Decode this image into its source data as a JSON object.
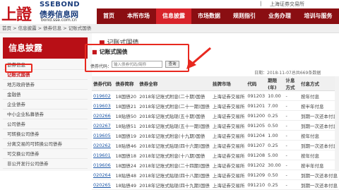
{
  "logo": {
    "cn": "上證",
    "en": "SSEBOND",
    "sub": "债券信息网",
    "url": "bond.sse.com.cn"
  },
  "topbar": {
    "sep": "|",
    "link": "上海证券交易所"
  },
  "nav": [
    {
      "label": "首页"
    },
    {
      "label": "本所市场"
    },
    {
      "label": "信息披露"
    },
    {
      "label": "市场数据"
    },
    {
      "label": "规则指引"
    },
    {
      "label": "业务办理"
    },
    {
      "label": "培训与服务"
    }
  ],
  "breadcrumb": "首页 > 信息披露 > 债券信息 > 记账式国债",
  "sidebar": {
    "title": "信息披露",
    "items": [
      {
        "label": "债券信息"
      },
      {
        "label": "记账式国债"
      },
      {
        "label": "地方政府债券"
      },
      {
        "label": "金融债"
      },
      {
        "label": "企业债券"
      },
      {
        "label": "中小企业私募债券"
      },
      {
        "label": "公司债券"
      },
      {
        "label": "可转换公司债券"
      },
      {
        "label": "分离交易的可转换公司债券"
      },
      {
        "label": "可交换公司债券"
      },
      {
        "label": "非公开发行公司债券"
      }
    ]
  },
  "content": {
    "title": "记账式国债",
    "search": {
      "title": "记账式国债",
      "label": "债券代码：",
      "placeholder": "输入债券代码/简称",
      "button": "查询"
    },
    "dateline": "日期：2018-11-07总共669条数据"
  },
  "table": {
    "headers": [
      "债券代码",
      "债券简称",
      "债券全称",
      "挂牌市场",
      "代码",
      "期限(年)",
      "计息方式",
      "付息方式"
    ],
    "rows": [
      [
        "019602",
        "18国债20",
        "2018年记账式附息(二十期)国债",
        "上海证券交易所",
        "091203",
        "10.00",
        "-",
        "按年付息"
      ],
      [
        "019603",
        "18国债21",
        "2018年记账式附息(二十一期)国债",
        "上海证券交易所",
        "091201",
        "7.00",
        "-",
        "按半年付息"
      ],
      [
        "020266",
        "18贴债50",
        "2018年记账式贴现(五十期)国债",
        "上海证券交易所",
        "091200",
        "0.25",
        "-",
        "到期一次还本付息"
      ],
      [
        "020267",
        "18贴债51",
        "2018年记账式贴现(五十一期)国债",
        "上海证券交易所",
        "091205",
        "0.50",
        "-",
        "到期一次还本付息"
      ],
      [
        "019605",
        "18国债19",
        "2018年记账式附息(十九期)国债",
        "上海证券交易所",
        "091204",
        "1.00",
        "-",
        "按年付息"
      ],
      [
        "020262",
        "18贴债46",
        "2018年记账式贴现(四十六期)国债",
        "上海证券交易所",
        "091207",
        "0.25",
        "-",
        "到期一次还本付息"
      ],
      [
        "019601",
        "18国债18",
        "2018年记账式附息(十八期)国债",
        "上海证券交易所",
        "091208",
        "5.00",
        "-",
        "按年付息"
      ],
      [
        "019606",
        "18国债24",
        "2018年记账式附息(二十四期)国债",
        "上海证券交易所",
        "091202",
        "30.00",
        "-",
        "按半年付息"
      ],
      [
        "020264",
        "18贴债48",
        "2018年记账式贴现(四十八期)国债",
        "上海证券交易所",
        "091209",
        "0.50",
        "-",
        "到期一次还本付息"
      ],
      [
        "020265",
        "18贴债49",
        "2018年记账式贴现(四十九期)国债",
        "上海证券交易所",
        "091210",
        "0.25",
        "-",
        "到期一次还本付息"
      ]
    ]
  },
  "colors": {
    "brand_red": "#c4161c",
    "nav_bg": "#8a0e12",
    "nav_active": "#d8232a",
    "annotation": "#e8281f",
    "link": "#1a55a6"
  }
}
